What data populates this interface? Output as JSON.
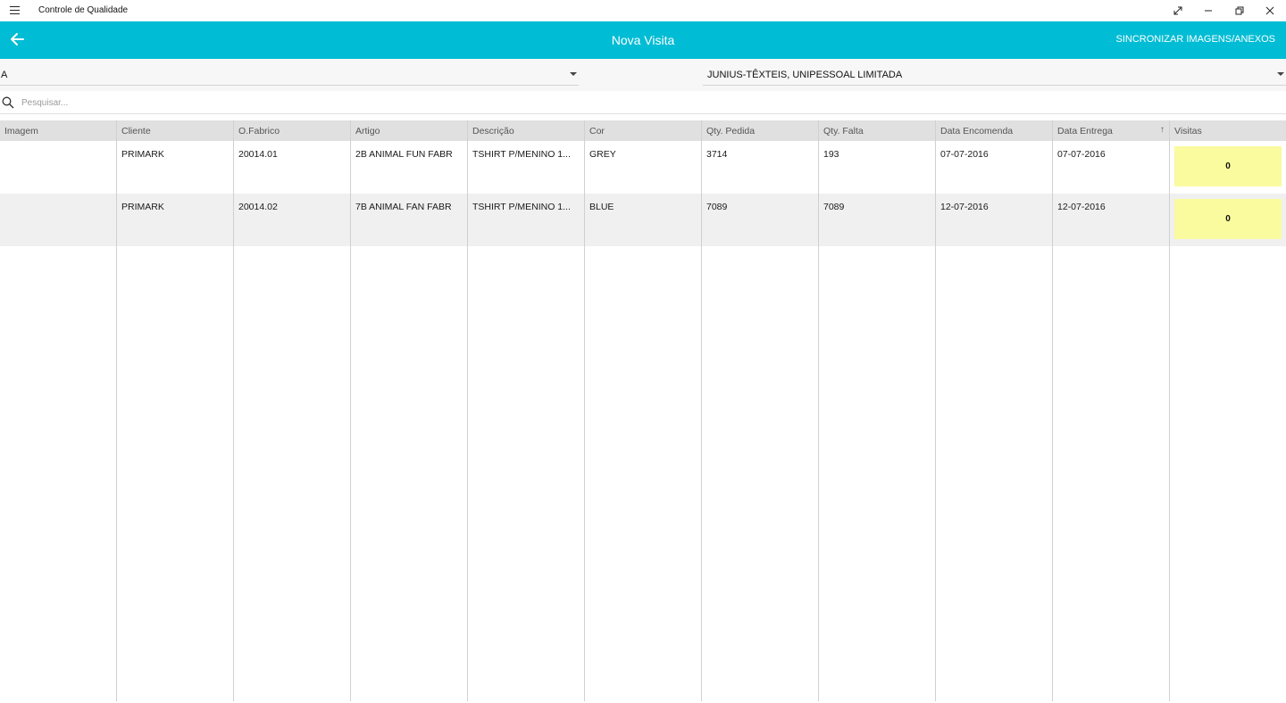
{
  "window": {
    "title": "Controle de Qualidade"
  },
  "header": {
    "title": "Nova Visita",
    "sync_label": "SINCRONIZAR IMAGENS/ANEXOS"
  },
  "filters": {
    "left_value": "A",
    "right_value": "JUNIUS-TÊXTEIS, UNIPESSOAL LIMITADA"
  },
  "search": {
    "placeholder": "Pesquisar..."
  },
  "grid": {
    "columns": [
      "Imagem",
      "Cliente",
      "O.Fabrico",
      "Artigo",
      "Descrição",
      "Cor",
      "Qty. Pedida",
      "Qty. Falta",
      "Data Encomenda",
      "Data Entrega",
      "Visitas"
    ],
    "sort_icon": "↑",
    "rows": [
      {
        "imagem": "",
        "cliente": "PRIMARK",
        "ofabrico": "20014.01",
        "artigo": "2B ANIMAL FUN FABR",
        "descricao": "TSHIRT P/MENINO 1...",
        "cor": "GREY",
        "qty_pedida": "3714",
        "qty_falta": "193",
        "data_encomenda": "07-07-2016",
        "data_entrega": "07-07-2016",
        "visitas": "0"
      },
      {
        "imagem": "",
        "cliente": "PRIMARK",
        "ofabrico": "20014.02",
        "artigo": "7B ANIMAL FAN FABR",
        "descricao": "TSHIRT P/MENINO 1...",
        "cor": "BLUE",
        "qty_pedida": "7089",
        "qty_falta": "7089",
        "data_encomenda": "12-07-2016",
        "data_entrega": "12-07-2016",
        "visitas": "0"
      }
    ]
  },
  "colors": {
    "accent": "#00bcd4",
    "visit_badge": "#fafa9e",
    "header_bg": "#e0e0e0",
    "row_alt": "#f0f0f0"
  },
  "icons": {
    "menu": "hamburger-icon",
    "back": "arrow-left-icon",
    "search": "search-icon",
    "dropdown": "chevron-down-icon",
    "fullscreen": "expand-icon",
    "minimize": "minimize-icon",
    "restore": "restore-icon",
    "close": "close-icon"
  }
}
